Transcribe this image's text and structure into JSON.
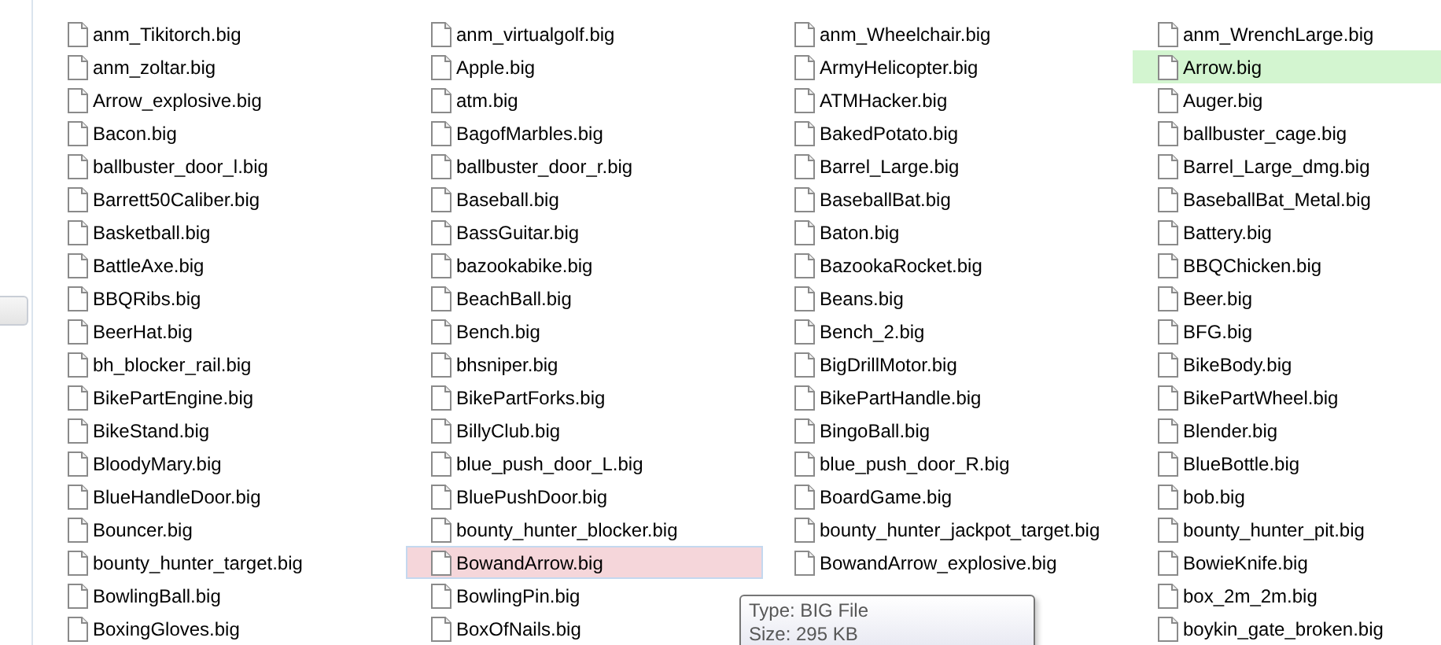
{
  "file_columns": [
    {
      "items": [
        {
          "name": "anm_Tikitorch.big",
          "selected": false,
          "hovered": false
        },
        {
          "name": "anm_zoltar.big",
          "selected": false,
          "hovered": false
        },
        {
          "name": "Arrow_explosive.big",
          "selected": false,
          "hovered": false
        },
        {
          "name": "Bacon.big",
          "selected": false,
          "hovered": false
        },
        {
          "name": "ballbuster_door_l.big",
          "selected": false,
          "hovered": false
        },
        {
          "name": "Barrett50Caliber.big",
          "selected": false,
          "hovered": false
        },
        {
          "name": "Basketball.big",
          "selected": false,
          "hovered": false
        },
        {
          "name": "BattleAxe.big",
          "selected": false,
          "hovered": false
        },
        {
          "name": "BBQRibs.big",
          "selected": false,
          "hovered": false
        },
        {
          "name": "BeerHat.big",
          "selected": false,
          "hovered": false
        },
        {
          "name": "bh_blocker_rail.big",
          "selected": false,
          "hovered": false
        },
        {
          "name": "BikePartEngine.big",
          "selected": false,
          "hovered": false
        },
        {
          "name": "BikeStand.big",
          "selected": false,
          "hovered": false
        },
        {
          "name": "BloodyMary.big",
          "selected": false,
          "hovered": false
        },
        {
          "name": "BlueHandleDoor.big",
          "selected": false,
          "hovered": false
        },
        {
          "name": "Bouncer.big",
          "selected": false,
          "hovered": false
        },
        {
          "name": "bounty_hunter_target.big",
          "selected": false,
          "hovered": false
        },
        {
          "name": "BowlingBall.big",
          "selected": false,
          "hovered": false
        },
        {
          "name": "BoxingGloves.big",
          "selected": false,
          "hovered": false
        }
      ]
    },
    {
      "items": [
        {
          "name": "anm_virtualgolf.big",
          "selected": false,
          "hovered": false
        },
        {
          "name": "Apple.big",
          "selected": false,
          "hovered": false
        },
        {
          "name": "atm.big",
          "selected": false,
          "hovered": false
        },
        {
          "name": "BagofMarbles.big",
          "selected": false,
          "hovered": false
        },
        {
          "name": "ballbuster_door_r.big",
          "selected": false,
          "hovered": false
        },
        {
          "name": "Baseball.big",
          "selected": false,
          "hovered": false
        },
        {
          "name": "BassGuitar.big",
          "selected": false,
          "hovered": false
        },
        {
          "name": "bazookabike.big",
          "selected": false,
          "hovered": false
        },
        {
          "name": "BeachBall.big",
          "selected": false,
          "hovered": false
        },
        {
          "name": "Bench.big",
          "selected": false,
          "hovered": false
        },
        {
          "name": "bhsniper.big",
          "selected": false,
          "hovered": false
        },
        {
          "name": "BikePartForks.big",
          "selected": false,
          "hovered": false
        },
        {
          "name": "BillyClub.big",
          "selected": false,
          "hovered": false
        },
        {
          "name": "blue_push_door_L.big",
          "selected": false,
          "hovered": false
        },
        {
          "name": "BluePushDoor.big",
          "selected": false,
          "hovered": false
        },
        {
          "name": "bounty_hunter_blocker.big",
          "selected": false,
          "hovered": false
        },
        {
          "name": "BowandArrow.big",
          "selected": false,
          "hovered": true
        },
        {
          "name": "BowlingPin.big",
          "selected": false,
          "hovered": false
        },
        {
          "name": "BoxOfNails.big",
          "selected": false,
          "hovered": false
        }
      ]
    },
    {
      "items": [
        {
          "name": "anm_Wheelchair.big",
          "selected": false,
          "hovered": false
        },
        {
          "name": "ArmyHelicopter.big",
          "selected": false,
          "hovered": false
        },
        {
          "name": "ATMHacker.big",
          "selected": false,
          "hovered": false
        },
        {
          "name": "BakedPotato.big",
          "selected": false,
          "hovered": false
        },
        {
          "name": "Barrel_Large.big",
          "selected": false,
          "hovered": false
        },
        {
          "name": "BaseballBat.big",
          "selected": false,
          "hovered": false
        },
        {
          "name": "Baton.big",
          "selected": false,
          "hovered": false
        },
        {
          "name": "BazookaRocket.big",
          "selected": false,
          "hovered": false
        },
        {
          "name": "Beans.big",
          "selected": false,
          "hovered": false
        },
        {
          "name": "Bench_2.big",
          "selected": false,
          "hovered": false
        },
        {
          "name": "BigDrillMotor.big",
          "selected": false,
          "hovered": false
        },
        {
          "name": "BikePartHandle.big",
          "selected": false,
          "hovered": false
        },
        {
          "name": "BingoBall.big",
          "selected": false,
          "hovered": false
        },
        {
          "name": "blue_push_door_R.big",
          "selected": false,
          "hovered": false
        },
        {
          "name": "BoardGame.big",
          "selected": false,
          "hovered": false
        },
        {
          "name": "bounty_hunter_jackpot_target.big",
          "selected": false,
          "hovered": false
        },
        {
          "name": "BowandArrow_explosive.big",
          "selected": false,
          "hovered": false
        }
      ]
    },
    {
      "items": [
        {
          "name": "anm_WrenchLarge.big",
          "selected": false,
          "hovered": false
        },
        {
          "name": "Arrow.big",
          "selected": true,
          "hovered": false
        },
        {
          "name": "Auger.big",
          "selected": false,
          "hovered": false
        },
        {
          "name": "ballbuster_cage.big",
          "selected": false,
          "hovered": false
        },
        {
          "name": "Barrel_Large_dmg.big",
          "selected": false,
          "hovered": false
        },
        {
          "name": "BaseballBat_Metal.big",
          "selected": false,
          "hovered": false
        },
        {
          "name": "Battery.big",
          "selected": false,
          "hovered": false
        },
        {
          "name": "BBQChicken.big",
          "selected": false,
          "hovered": false
        },
        {
          "name": "Beer.big",
          "selected": false,
          "hovered": false
        },
        {
          "name": "BFG.big",
          "selected": false,
          "hovered": false
        },
        {
          "name": "BikeBody.big",
          "selected": false,
          "hovered": false
        },
        {
          "name": "BikePartWheel.big",
          "selected": false,
          "hovered": false
        },
        {
          "name": "Blender.big",
          "selected": false,
          "hovered": false
        },
        {
          "name": "BlueBottle.big",
          "selected": false,
          "hovered": false
        },
        {
          "name": "bob.big",
          "selected": false,
          "hovered": false
        },
        {
          "name": "bounty_hunter_pit.big",
          "selected": false,
          "hovered": false
        },
        {
          "name": "BowieKnife.big",
          "selected": false,
          "hovered": false
        },
        {
          "name": "box_2m_2m.big",
          "selected": false,
          "hovered": false
        },
        {
          "name": "boykin_gate_broken.big",
          "selected": false,
          "hovered": false
        }
      ]
    }
  ],
  "tooltip": {
    "lines": [
      "Type: BIG File",
      "Size: 295 KB"
    ]
  }
}
